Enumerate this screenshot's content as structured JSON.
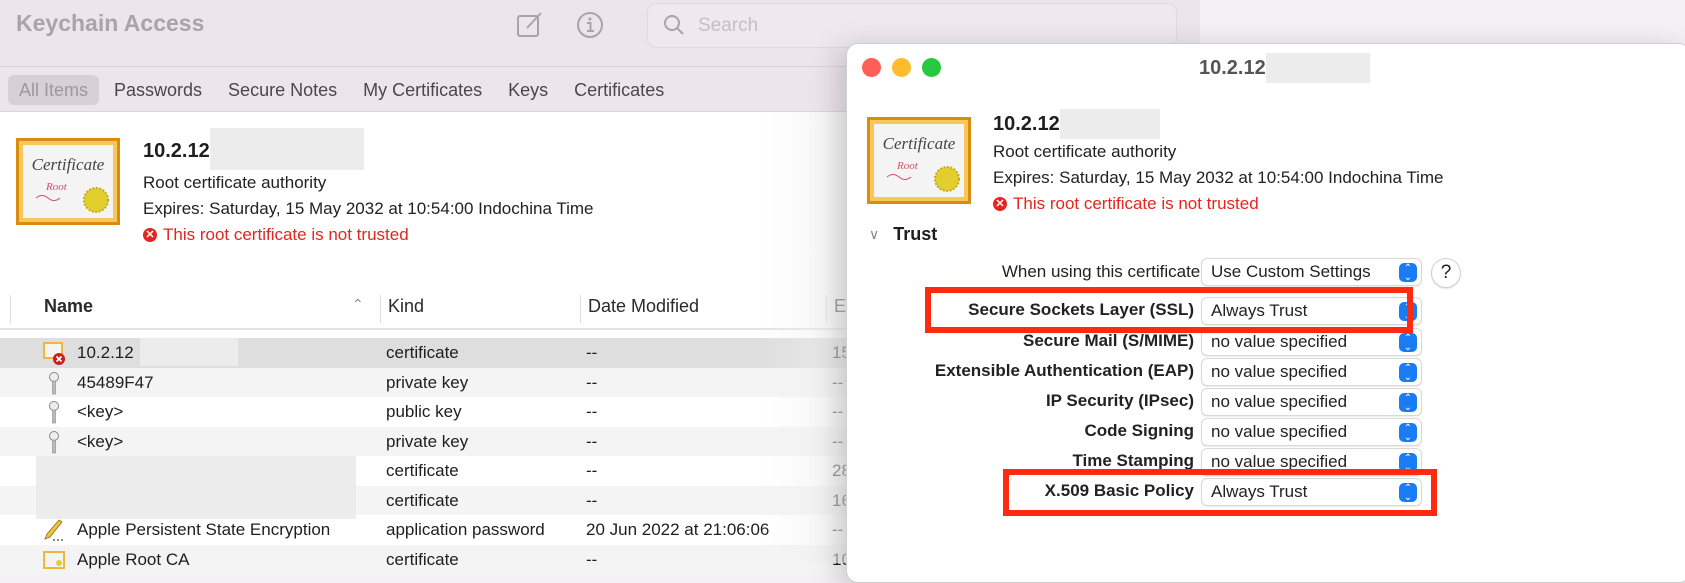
{
  "main_window": {
    "title": "Keychain Access",
    "toolbar": {
      "new_item_icon": "compose-icon",
      "info_icon": "info-icon",
      "search_placeholder": "Search",
      "search_value": ""
    },
    "tabs": [
      {
        "label": "All Items",
        "active": true
      },
      {
        "label": "Passwords",
        "active": false
      },
      {
        "label": "Secure Notes",
        "active": false
      },
      {
        "label": "My Certificates",
        "active": false
      },
      {
        "label": "Keys",
        "active": false
      },
      {
        "label": "Certificates",
        "active": false
      }
    ],
    "selected_item": {
      "name": "10.2.12",
      "subtitle": "Root certificate authority",
      "expires": "Expires: Saturday, 15 May 2032 at 10:54:00 Indochina Time",
      "warning": "This root certificate is not trusted"
    },
    "table": {
      "columns": [
        "Name",
        "Kind",
        "Date Modified",
        "E"
      ],
      "rows": [
        {
          "icon": "certificate-untrusted-icon",
          "name": "10.2.12",
          "kind": "certificate",
          "date": "--",
          "expires": "15"
        },
        {
          "icon": "key-icon",
          "name": "45489F47",
          "kind": "private key",
          "date": "--",
          "expires": "--"
        },
        {
          "icon": "key-icon",
          "name": "<key>",
          "kind": "public key",
          "date": "--",
          "expires": "--"
        },
        {
          "icon": "key-icon",
          "name": "<key>",
          "kind": "private key",
          "date": "--",
          "expires": "--"
        },
        {
          "icon": "",
          "name": "",
          "kind": "certificate",
          "date": "--",
          "expires": "28"
        },
        {
          "icon": "",
          "name": "",
          "kind": "certificate",
          "date": "--",
          "expires": "16"
        },
        {
          "icon": "pencil-icon",
          "name": "Apple Persistent State Encryption",
          "kind": "application password",
          "date": "20 Jun 2022 at 21:06:06",
          "expires": "--"
        },
        {
          "icon": "certificate-icon",
          "name": "Apple Root CA",
          "kind": "certificate",
          "date": "--",
          "expires": "10"
        }
      ]
    }
  },
  "dialog": {
    "title": "10.2.12",
    "cert": {
      "name": "10.2.12",
      "subtitle": "Root certificate authority",
      "expires": "Expires: Saturday, 15 May 2032 at 10:54:00 Indochina Time",
      "warning": "This root certificate is not trusted"
    },
    "trust": {
      "section_label": "Trust",
      "using_label": "When using this certificate:",
      "using_value": "Use Custom Settings",
      "help_label": "?",
      "policies": [
        {
          "label": "Secure Sockets Layer (SSL)",
          "value": "Always Trust",
          "highlighted": true
        },
        {
          "label": "Secure Mail (S/MIME)",
          "value": "no value specified",
          "highlighted": false
        },
        {
          "label": "Extensible Authentication (EAP)",
          "value": "no value specified",
          "highlighted": false
        },
        {
          "label": "IP Security (IPsec)",
          "value": "no value specified",
          "highlighted": false
        },
        {
          "label": "Code Signing",
          "value": "no value specified",
          "highlighted": false
        },
        {
          "label": "Time Stamping",
          "value": "no value specified",
          "highlighted": false
        },
        {
          "label": "X.509 Basic Policy",
          "value": "Always Trust",
          "highlighted": true
        }
      ]
    }
  },
  "colors": {
    "warning_red": "#e3261f",
    "highlight_red": "#ff2a0f",
    "accent_blue": "#1a7cf5"
  }
}
